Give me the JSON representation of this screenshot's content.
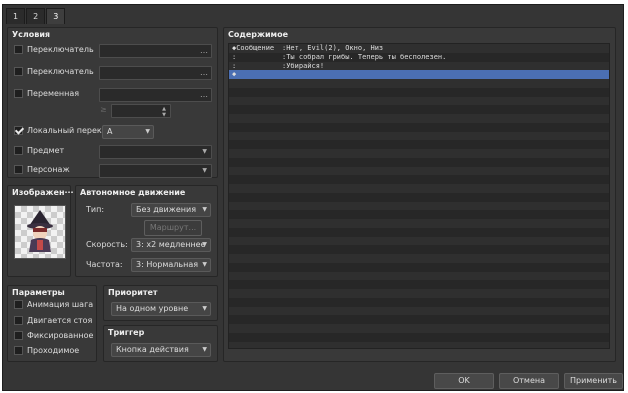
{
  "tabs": [
    "1",
    "2",
    "3"
  ],
  "conditions": {
    "title": "Условия",
    "switch1_label": "Переключатель",
    "switch2_label": "Переключатель",
    "variable_label": "Переменная",
    "self_switch_label": "Локальный перек",
    "self_switch_value": "A",
    "item_label": "Предмет",
    "actor_label": "Персонаж"
  },
  "image": {
    "title": "Изображен"
  },
  "movement": {
    "title": "Автономное движение",
    "type_label": "Тип:",
    "type_value": "Без движения",
    "route_button": "Маршрут...",
    "speed_label": "Скорость:",
    "speed_value": "3: x2 медленнее",
    "freq_label": "Частота:",
    "freq_value": "3: Нормальная"
  },
  "options": {
    "title": "Параметры",
    "walking": "Анимация шага",
    "stepping": "Двигается стоя",
    "direction_fix": "Фиксированное",
    "through": "Проходимое"
  },
  "priority": {
    "title": "Приоритет",
    "value": "На одном уровне"
  },
  "trigger": {
    "title": "Триггер",
    "value": "Кнопка действия"
  },
  "contents": {
    "title": "Содержимое",
    "rows": [
      {
        "a": "◆Сообщение",
        "b": ":Нет, Evil(2), Окно, Низ"
      },
      {
        "a": ":",
        "b": ":Ты собрал грибы. Теперь ты бесполезен."
      },
      {
        "a": ":",
        "b": ":Убирайся!"
      },
      {
        "a": "◆",
        "b": ""
      }
    ]
  },
  "footer": {
    "ok": "OK",
    "cancel": "Отмена",
    "apply": "Применить"
  }
}
